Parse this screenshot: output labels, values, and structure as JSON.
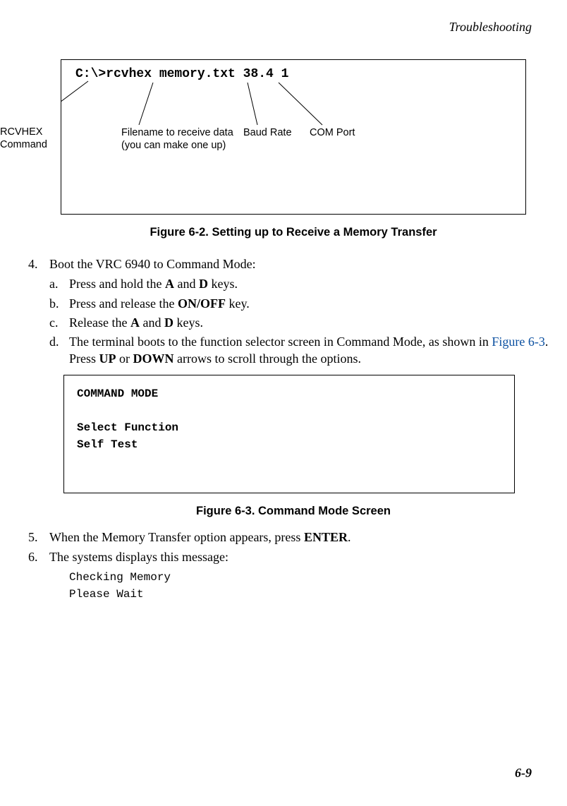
{
  "header": {
    "section": "Troubleshooting",
    "page_number": "6-9"
  },
  "figure62": {
    "command_line": "C:\\>rcvhex memory.txt 38.4 1",
    "callouts": {
      "rcvhex": "RCVHEX\nCommand",
      "filename": "Filename to receive data\n(you can make one up)",
      "baud": "Baud Rate",
      "com": "COM Port"
    },
    "caption": "Figure 6-2.  Setting up to Receive a Memory Transfer"
  },
  "steps": {
    "s4": {
      "num": "4.",
      "text": "Boot the VRC 6940 to Command Mode:",
      "a_let": "a.",
      "a_pre": "Press and hold the ",
      "a_key1": "A",
      "a_mid": " and ",
      "a_key2": "D",
      "a_post": " keys.",
      "b_let": "b.",
      "b_pre": "Press and release the ",
      "b_key": "ON/OFF",
      "b_post": " key.",
      "c_let": "c.",
      "c_pre": "Release the ",
      "c_key1": "A",
      "c_mid": " and ",
      "c_key2": "D",
      "c_post": " keys.",
      "d_let": "d.",
      "d_pre": "The terminal boots to the function selector screen in Command Mode, as shown in ",
      "d_link": "Figure 6-3",
      "d_mid": ". Press ",
      "d_key1": "UP",
      "d_mid2": " or ",
      "d_key2": "DOWN",
      "d_post": " arrows to scroll through the options."
    },
    "s5": {
      "num": "5.",
      "pre": "When the Memory Transfer option appears, press ",
      "key": "ENTER",
      "post": "."
    },
    "s6": {
      "num": "6.",
      "text": "The systems displays this message:"
    }
  },
  "figure63": {
    "line1": "COMMAND MODE",
    "line2": "Select Function",
    "line3": "Self Test",
    "caption": "Figure 6-3.  Command Mode Screen"
  },
  "code": {
    "l1": "Checking Memory",
    "l2": "Please Wait"
  }
}
